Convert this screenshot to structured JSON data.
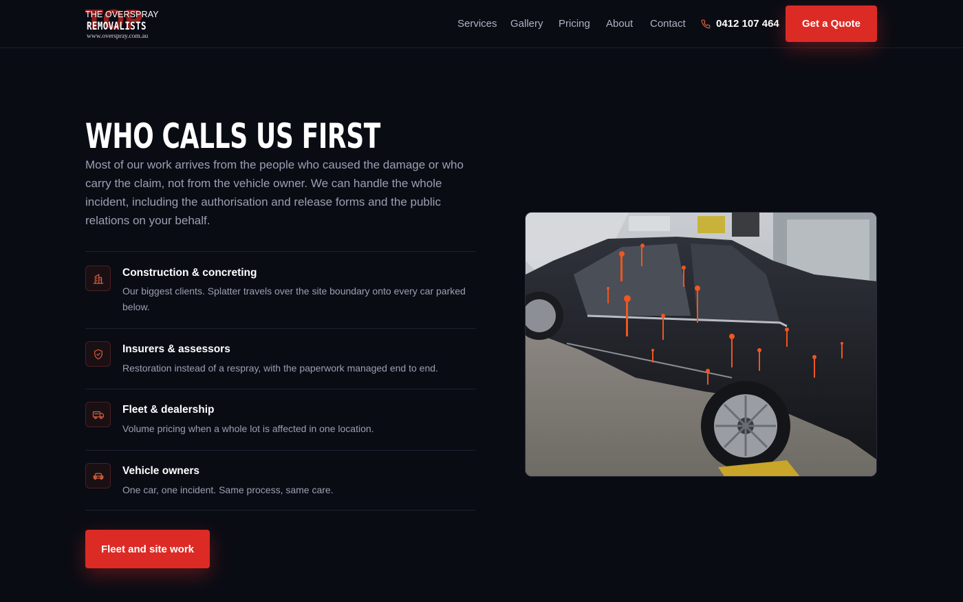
{
  "header": {
    "logo": {
      "line1": "THE OVERSPRAY",
      "line2": "REMOVALISTS",
      "line3": "www.overspray.com.au",
      "bg_text": "TOP"
    },
    "nav": [
      "Services",
      "Gallery",
      "Pricing",
      "About",
      "Contact"
    ],
    "phone_icon": "phone-icon",
    "phone": "0412 107 464",
    "cta": "Get a Quote"
  },
  "main": {
    "heading": "WHO CALLS US FIRST",
    "intro": "Most of our work arrives from the people who caused the damage or who carry the claim, not from the vehicle owner. We can handle the whole incident, including the authorisation and release forms and the public relations on your behalf.",
    "items": [
      {
        "icon": "building-icon",
        "title": "Construction & concreting",
        "desc": "Our biggest clients. Splatter travels over the site boundary onto every car parked below."
      },
      {
        "icon": "shield-check-icon",
        "title": "Insurers & assessors",
        "desc": "Restoration instead of a respray, with the paperwork managed end to end."
      },
      {
        "icon": "truck-icon",
        "title": "Fleet & dealership",
        "desc": "Volume pricing when a whole lot is affected in one location."
      },
      {
        "icon": "car-icon",
        "title": "Vehicle owners",
        "desc": "One car, one incident. Same process, same care."
      }
    ],
    "cta": "Fleet and site work"
  },
  "colors": {
    "background": "#0a0c14",
    "accent": "#dc2b25",
    "icon_accent": "#e0613a",
    "text_muted": "#9aa0b2"
  }
}
